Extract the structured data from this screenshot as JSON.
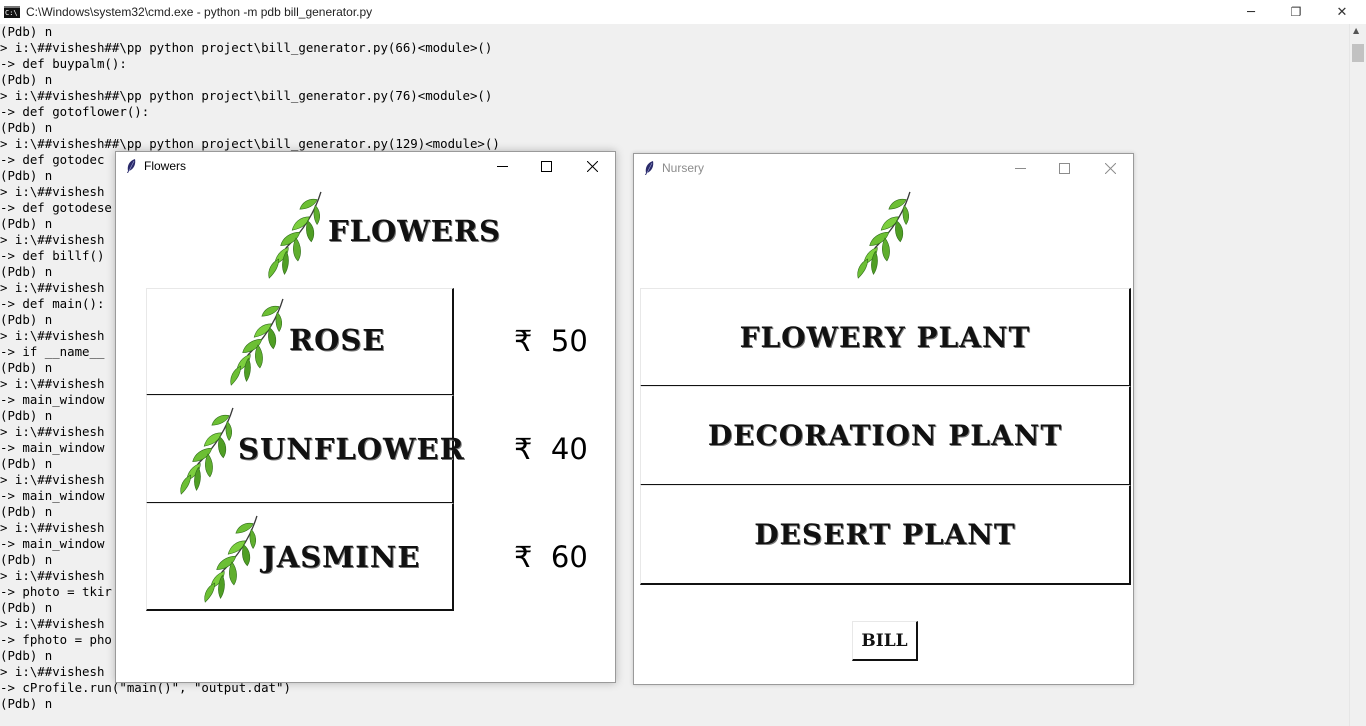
{
  "console": {
    "title": "C:\\Windows\\system32\\cmd.exe - python  -m pdb bill_generator.py",
    "app_icon": "cmd-icon",
    "lines": [
      "(Pdb) n",
      "> i:\\##vishesh##\\pp python project\\bill_generator.py(66)<module>()",
      "-> def buypalm():",
      "(Pdb) n",
      "> i:\\##vishesh##\\pp python project\\bill_generator.py(76)<module>()",
      "-> def gotoflower():",
      "(Pdb) n",
      "> i:\\##vishesh##\\pp python project\\bill_generator.py(129)<module>()",
      "-> def gotodec",
      "(Pdb) n",
      "> i:\\##vishesh",
      "-> def gotodese",
      "(Pdb) n",
      "> i:\\##vishesh",
      "-> def billf()",
      "(Pdb) n",
      "> i:\\##vishesh",
      "-> def main():",
      "(Pdb) n",
      "> i:\\##vishesh",
      "-> if __name__",
      "(Pdb) n",
      "> i:\\##vishesh",
      "-> main_window",
      "(Pdb) n",
      "> i:\\##vishesh",
      "-> main_window",
      "(Pdb) n",
      "> i:\\##vishesh",
      "-> main_window",
      "(Pdb) n",
      "> i:\\##vishesh",
      "-> main_window",
      "(Pdb) n",
      "> i:\\##vishesh",
      "-> photo = tkir",
      "(Pdb) n",
      "> i:\\##vishesh",
      "-> fphoto = pho",
      "(Pdb) n",
      "> i:\\##vishesh",
      "-> cProfile.run(\"main()\", \"output.dat\")",
      "(Pdb) n"
    ]
  },
  "window_controls": {
    "minimize": "─",
    "maximize": "❐",
    "close": "✕"
  },
  "flowers_window": {
    "title": "Flowers",
    "heading": "FLOWERS",
    "items": [
      {
        "name": "ROSE",
        "currency": "₹",
        "price": "50"
      },
      {
        "name": "SUNFLOWER",
        "currency": "₹",
        "price": "40"
      },
      {
        "name": "JASMINE",
        "currency": "₹",
        "price": "60"
      }
    ]
  },
  "nursery_window": {
    "title": "Nursery",
    "buttons": [
      "FLOWERY PLANT",
      "DECORATION PLANT",
      "DESERT PLANT"
    ],
    "bill_label": "BILL"
  },
  "colors": {
    "leaf_green": "#5fae2e",
    "leaf_dark": "#2f6b1a",
    "stem": "#3a3a3a"
  }
}
